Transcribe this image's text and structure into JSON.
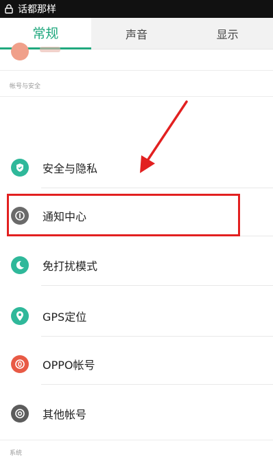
{
  "statusbar": {
    "app_title": "话都那样",
    "icon": "lock-icon"
  },
  "tabs": [
    {
      "label": "常规",
      "active": true
    },
    {
      "label": "声音",
      "active": false
    },
    {
      "label": "显示",
      "active": false
    }
  ],
  "sections": {
    "account_security_label": "帐号与安全",
    "system_label": "系统"
  },
  "items": [
    {
      "label": "安全与隐私",
      "icon": "shield-icon",
      "color": "#2fb89a"
    },
    {
      "label": "通知中心",
      "icon": "info-circle-icon",
      "color": "#6a6a6a"
    },
    {
      "label": "免打扰模式",
      "icon": "moon-icon",
      "color": "#2fb89a"
    },
    {
      "label": "GPS定位",
      "icon": "location-pin-icon",
      "color": "#2fb89a"
    },
    {
      "label": "OPPO帐号",
      "icon": "account-icon",
      "color": "#e85a45"
    },
    {
      "label": "其他帐号",
      "icon": "at-sign-icon",
      "color": "#5c5c5c"
    }
  ],
  "annotation": {
    "color": "#e22020"
  }
}
